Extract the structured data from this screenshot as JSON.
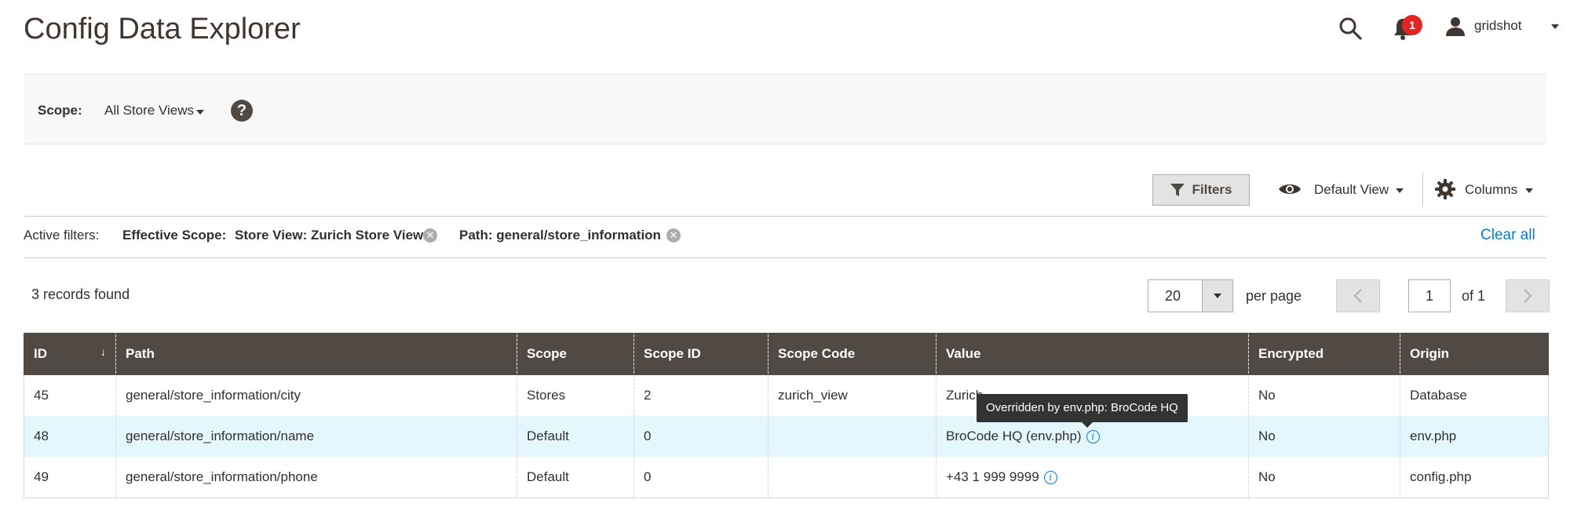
{
  "header": {
    "title": "Config Data Explorer",
    "notification_count": "1",
    "username": "gridshot",
    "icons": [
      "search-icon",
      "bell-icon",
      "user-icon"
    ]
  },
  "scope": {
    "label": "Scope:",
    "value": "All Store Views",
    "help": "?"
  },
  "toolbar": {
    "filters_label": "Filters",
    "view_label": "Default View",
    "columns_label": "Columns"
  },
  "active_filters": {
    "label": "Active filters:",
    "chips": [
      {
        "label": "Effective Scope:",
        "value": "Store View: Zurich Store View"
      },
      {
        "label": "",
        "value": "Path: general/store_information"
      }
    ],
    "clear_all": "Clear all"
  },
  "records": {
    "text": "3 records found"
  },
  "pager": {
    "per_page_value": "20",
    "per_page_label": "per page",
    "current_page": "1",
    "of_label": "of 1"
  },
  "table": {
    "columns": [
      "ID",
      "Path",
      "Scope",
      "Scope ID",
      "Scope Code",
      "Value",
      "Encrypted",
      "Origin"
    ],
    "sort_indicator": "↓",
    "rows": [
      {
        "id": "45",
        "path": "general/store_information/city",
        "scope": "Stores",
        "scope_id": "2",
        "scope_code": "zurich_view",
        "value": "Zurich",
        "encrypted": "No",
        "origin": "Database",
        "info": false
      },
      {
        "id": "48",
        "path": "general/store_information/name",
        "scope": "Default",
        "scope_id": "0",
        "scope_code": "",
        "value": "BroCode HQ (env.php)",
        "encrypted": "No",
        "origin": "env.php",
        "info": true
      },
      {
        "id": "49",
        "path": "general/store_information/phone",
        "scope": "Default",
        "scope_id": "0",
        "scope_code": "",
        "value": "+43 1 999 9999",
        "encrypted": "No",
        "origin": "config.php",
        "info": true
      }
    ]
  },
  "tooltip": {
    "text": "Overridden by env.php: BroCode HQ"
  },
  "colors": {
    "header_bg": "#514943",
    "link": "#007bdb",
    "badge": "#e22626",
    "highlight_row": "#e5f7fe"
  }
}
